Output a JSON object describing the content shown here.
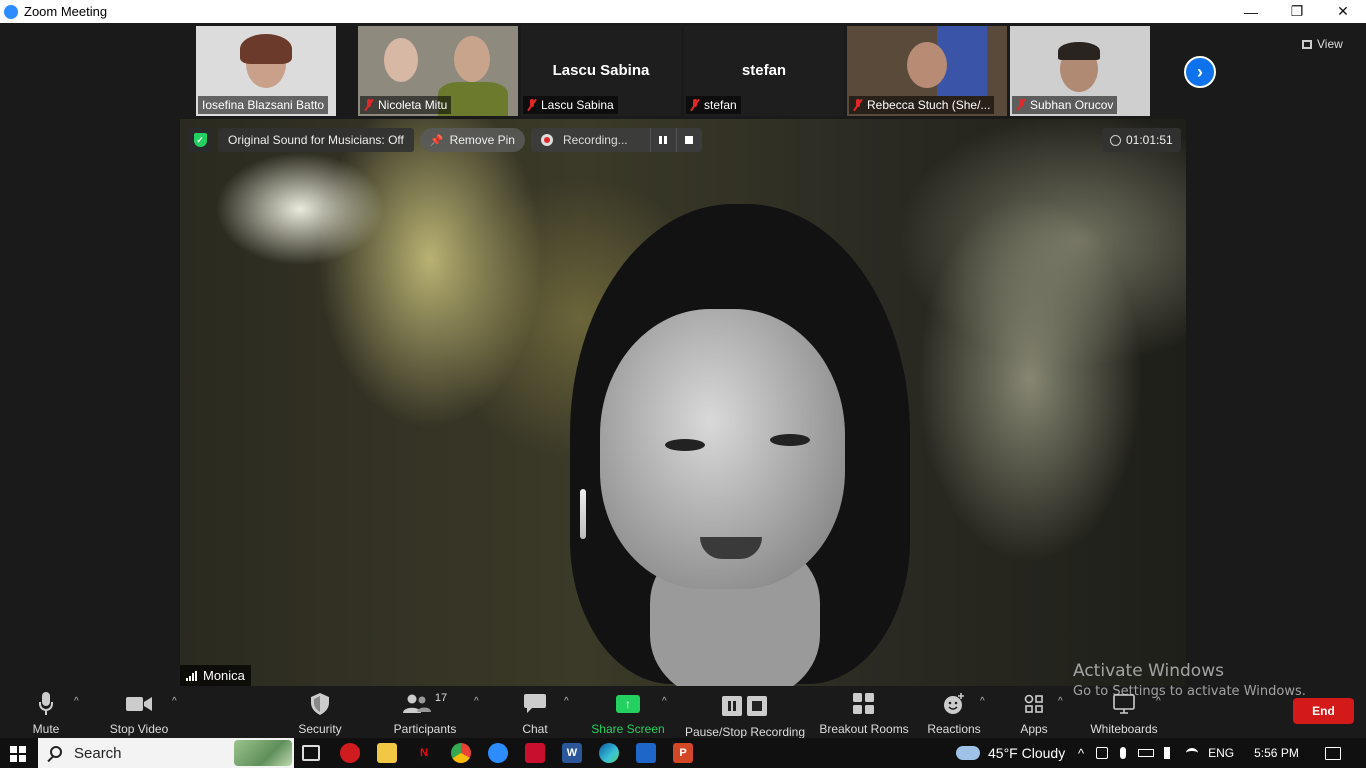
{
  "window": {
    "title": "Zoom Meeting",
    "minimize": "—",
    "restore": "❐",
    "close": "✕"
  },
  "participants": [
    {
      "name": "Iosefina Blazsani Batto",
      "muted": false
    },
    {
      "name": "Nicoleta Mitu",
      "muted": true
    },
    {
      "name": "Lascu Sabina",
      "muted": true,
      "display_name": "Lascu Sabina"
    },
    {
      "name": "stefan",
      "muted": true,
      "display_name": "stefan"
    },
    {
      "name": "Rebecca Stuch (She/...",
      "muted": true
    },
    {
      "name": "Subhan Orucov",
      "muted": true
    }
  ],
  "view_button": "View",
  "next_icon": "›",
  "overlay": {
    "original_sound": "Original Sound for Musicians: Off",
    "remove_pin": "Remove Pin",
    "recording": "Recording...",
    "timer": "01:01:51",
    "shield_glyph": "✓",
    "pin_glyph": "📌"
  },
  "speaker": {
    "name": "Monica"
  },
  "toolbar": {
    "mute": "Mute",
    "stop_video": "Stop Video",
    "security": "Security",
    "participants": "Participants",
    "participants_count": "17",
    "chat": "Chat",
    "share_screen": "Share Screen",
    "pause_stop_recording": "Pause/Stop Recording",
    "breakout_rooms": "Breakout Rooms",
    "reactions": "Reactions",
    "apps": "Apps",
    "whiteboards": "Whiteboards",
    "end": "End",
    "caret": "^",
    "share_arrow": "↑"
  },
  "watermark": {
    "line1": "Activate Windows",
    "line2": "Go to Settings to activate Windows."
  },
  "taskbar": {
    "search": "Search",
    "weather": "45°F  Cloudy",
    "lang": "ENG",
    "time": "5:56 PM",
    "tray_caret": "^"
  },
  "colors": {
    "accent": "#2d8cff",
    "share_green": "#23d160",
    "end_red": "#d41919",
    "muted_red": "#e02828"
  }
}
